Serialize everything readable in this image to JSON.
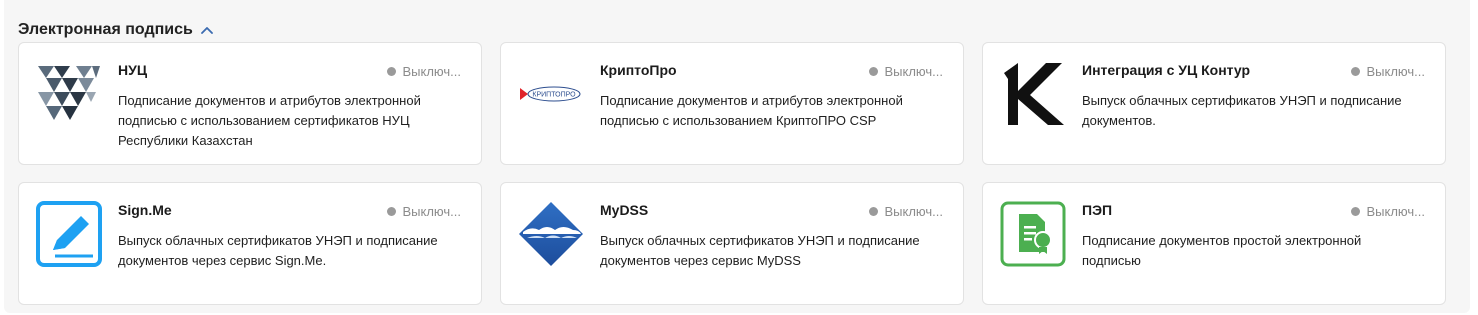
{
  "section": {
    "title": "Электронная подпись"
  },
  "colors": {
    "accent": "#3b6bb0",
    "status_dot": "#9a9a9a",
    "signme_blue": "#1ea1f2",
    "pep_green": "#4caf50",
    "nuc_dark": "#3c4a5a"
  },
  "cards": [
    {
      "name": "НУЦ",
      "status": "Выключ...",
      "description": "Подписание документов и атрибутов электронной подписью с использованием сертификатов НУЦ Республики Казахстан",
      "icon": "nuc-logo-icon"
    },
    {
      "name": "КриптоПро",
      "status": "Выключ...",
      "description": "Подписание документов и атрибутов электронной подписью с использованием КриптоПРО CSP",
      "icon": "cryptopro-logo-icon",
      "logo_text": "КРИПТОПРО"
    },
    {
      "name": "Интеграция с УЦ Контур",
      "status": "Выключ...",
      "description": "Выпуск облачных сертификатов УНЭП и подписание документов.",
      "icon": "kontur-logo-icon"
    },
    {
      "name": "Sign.Me",
      "status": "Выключ...",
      "description": "Выпуск облачных сертификатов УНЭП и подписание документов через сервис Sign.Me.",
      "icon": "signme-logo-icon"
    },
    {
      "name": "MyDSS",
      "status": "Выключ...",
      "description": "Выпуск облачных сертификатов УНЭП и подписание документов через сервис MyDSS",
      "icon": "mydss-logo-icon"
    },
    {
      "name": "ПЭП",
      "status": "Выключ...",
      "description": "Подписание документов простой электронной подписью",
      "icon": "pep-logo-icon"
    }
  ]
}
